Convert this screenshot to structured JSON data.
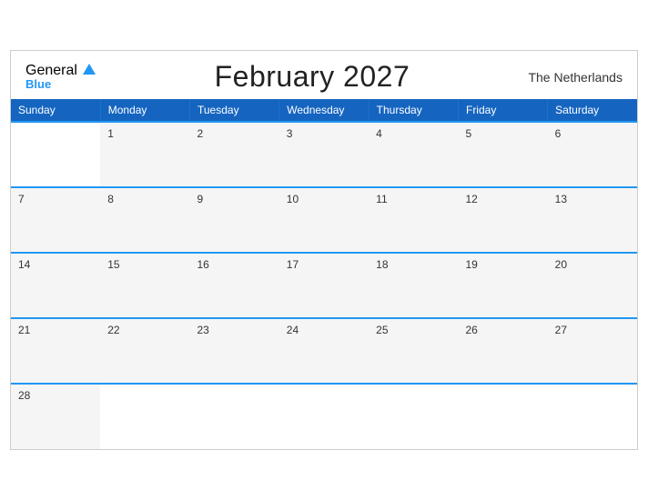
{
  "header": {
    "title": "February 2027",
    "country": "The Netherlands",
    "logo_general": "General",
    "logo_blue": "Blue"
  },
  "weekdays": [
    "Sunday",
    "Monday",
    "Tuesday",
    "Wednesday",
    "Thursday",
    "Friday",
    "Saturday"
  ],
  "weeks": [
    [
      null,
      1,
      2,
      3,
      4,
      5,
      6
    ],
    [
      7,
      8,
      9,
      10,
      11,
      12,
      13
    ],
    [
      14,
      15,
      16,
      17,
      18,
      19,
      20
    ],
    [
      21,
      22,
      23,
      24,
      25,
      26,
      27
    ],
    [
      28,
      null,
      null,
      null,
      null,
      null,
      null
    ]
  ],
  "colors": {
    "header_bg": "#1565C0",
    "accent": "#2196F3",
    "row_bg": "#f5f5f5",
    "empty_bg": "#ffffff"
  }
}
